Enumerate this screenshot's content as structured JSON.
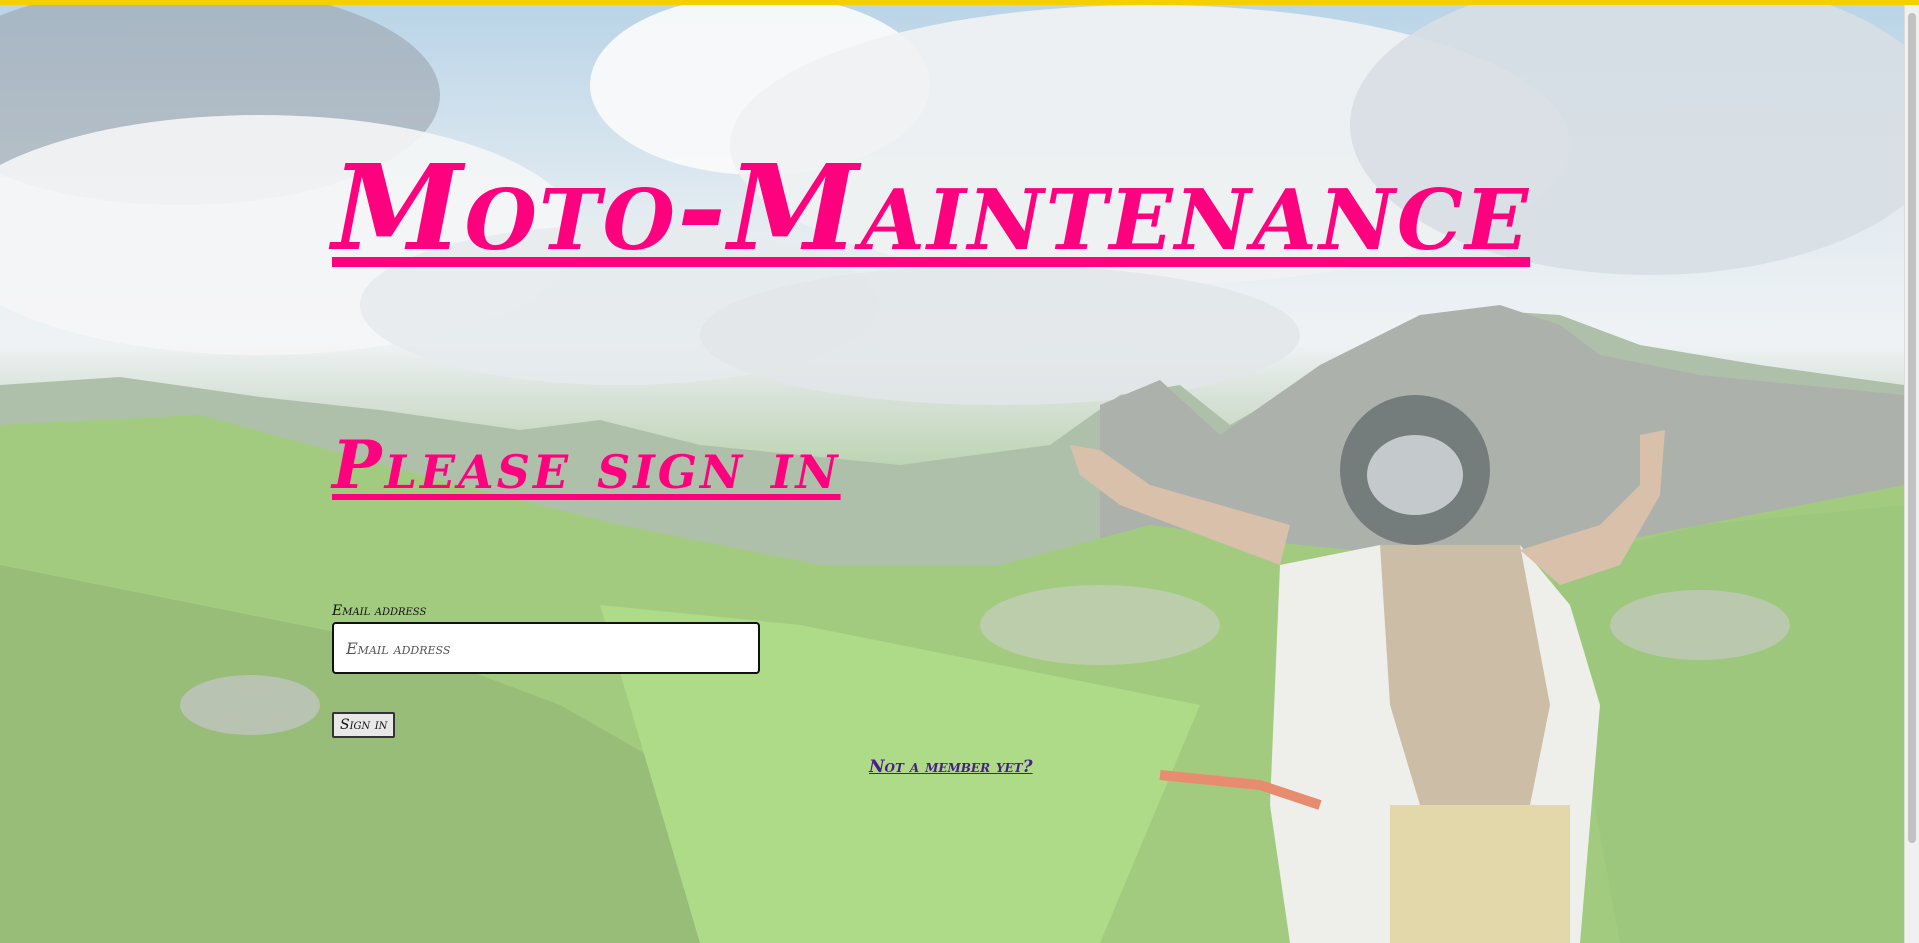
{
  "page": {
    "title": "Moto-Maintenance",
    "accent_color": "#ff007f",
    "link_color": "#4b1a8c",
    "top_bar_color": "#f5d000",
    "background_image": "mountain-landscape-motorcyclist"
  },
  "header": {
    "title": "Moto-Maintenance"
  },
  "signin": {
    "heading": "Please sign in",
    "email_label": "Email address",
    "email_placeholder": "Email address",
    "email_value": "",
    "button_label": "Sign in",
    "register_link": "Not a member yet?"
  }
}
